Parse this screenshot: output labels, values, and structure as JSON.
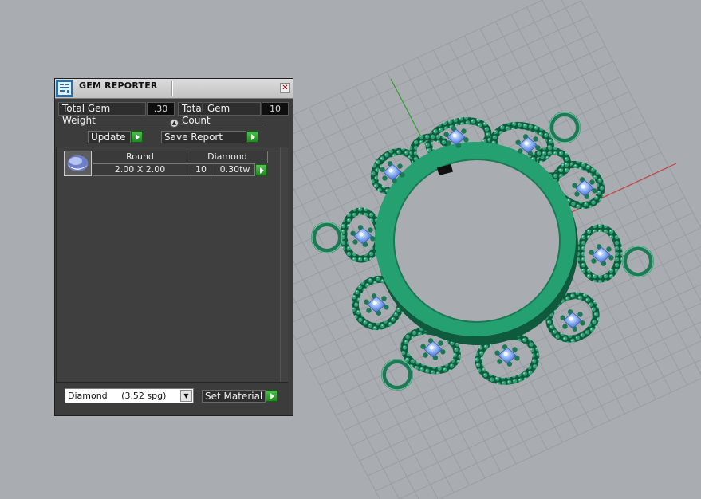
{
  "panel": {
    "title": "GEM REPORTER",
    "close_label": "✕",
    "total_weight_label": "Total Gem Weight",
    "total_weight_value": ".30",
    "total_count_label": "Total Gem Count",
    "total_count_value": "10",
    "update_label": "Update",
    "save_report_label": "Save Report",
    "gem_row": {
      "shape": "Round",
      "material": "Diamond",
      "size": "2.00 X 2.00",
      "count": "10",
      "weight": "0.30tw"
    },
    "material_select_value": "Diamond     (3.52 spg)",
    "set_material_label": "Set Material"
  },
  "icons": [
    "gem-reporter-app-icon",
    "close-icon",
    "slider-knob-icon",
    "play-arrow-icon",
    "gem-thumbnail-icon",
    "chevron-down-icon"
  ],
  "colors": {
    "viewport_bg": "#a9acb0",
    "grid_line": "#9b9ea3",
    "axis_x": "#c43a3a",
    "axis_y": "#2aa02a",
    "model_green": "#1f8f63",
    "gem_blue": "#7aa6f0",
    "panel_bg": "#3c3c3c",
    "button_green": "#2fa52f"
  }
}
